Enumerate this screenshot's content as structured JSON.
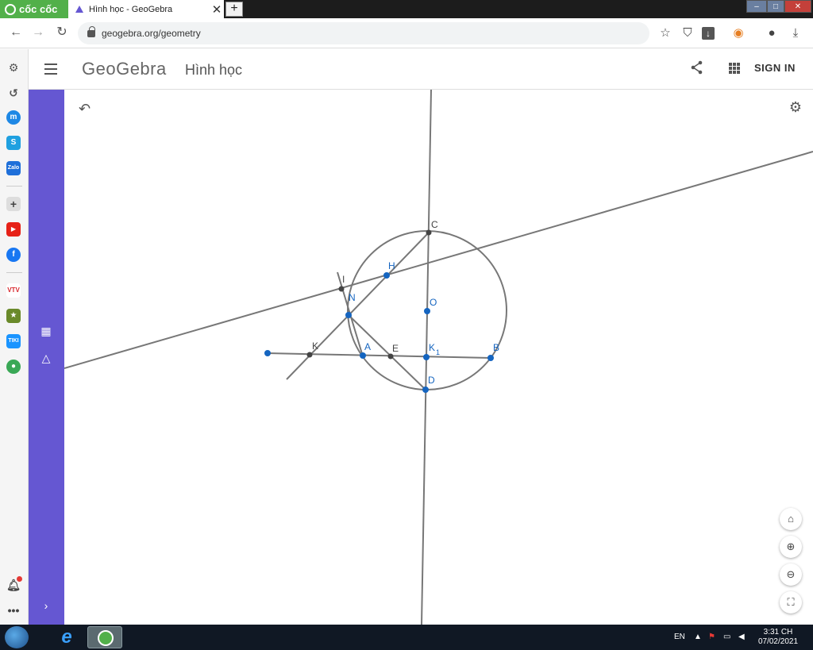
{
  "browser": {
    "brand": "cốc cốc",
    "tab_title": "Hình học - GeoGebra",
    "tab_close": "✕",
    "new_tab": "+",
    "url": "geogebra.org/geometry"
  },
  "header": {
    "logo": "GeoGebra",
    "app_name": "Hình học",
    "sign_in": "SIGN IN"
  },
  "sidebar": {
    "items": [
      {
        "name": "settings-icon",
        "color": "#555555",
        "glyph": "⚙"
      },
      {
        "name": "history-icon",
        "color": "#555555",
        "glyph": "↺"
      },
      {
        "name": "messenger-icon",
        "color": "#1e88e5",
        "glyph": "m"
      },
      {
        "name": "skype-icon",
        "color": "#1fa0e0",
        "glyph": "S"
      },
      {
        "name": "zalo-icon",
        "color": "#1e6fd9",
        "glyph": "Z"
      },
      {
        "name": "add-icon",
        "color": "#888888",
        "glyph": "+"
      },
      {
        "name": "youtube-icon",
        "color": "#e62117",
        "glyph": "▶"
      },
      {
        "name": "facebook-icon",
        "color": "#1877f2",
        "glyph": "f"
      },
      {
        "name": "vtv-icon",
        "color": "#d7262b",
        "glyph": "V"
      },
      {
        "name": "game-icon",
        "color": "#6a8a2a",
        "glyph": "★"
      },
      {
        "name": "tiki-icon",
        "color": "#1a94ff",
        "glyph": "T"
      },
      {
        "name": "map-icon",
        "color": "#3aa856",
        "glyph": "●"
      }
    ]
  },
  "geometry": {
    "point_labels": {
      "C": "C",
      "H": "H",
      "I": "I",
      "N": "N",
      "O": "O",
      "K": "K",
      "A": "A",
      "E": "E",
      "K1": "K",
      "K1_sub": "1",
      "B": "B",
      "D": "D"
    }
  },
  "taskbar": {
    "lang": "EN",
    "time": "3:31 CH",
    "date": "07/02/2021"
  },
  "colors": {
    "toolstrip": "#6557d2",
    "point_blue": "#1565c0",
    "point_dark": "#444444",
    "line_gray": "#777777"
  }
}
